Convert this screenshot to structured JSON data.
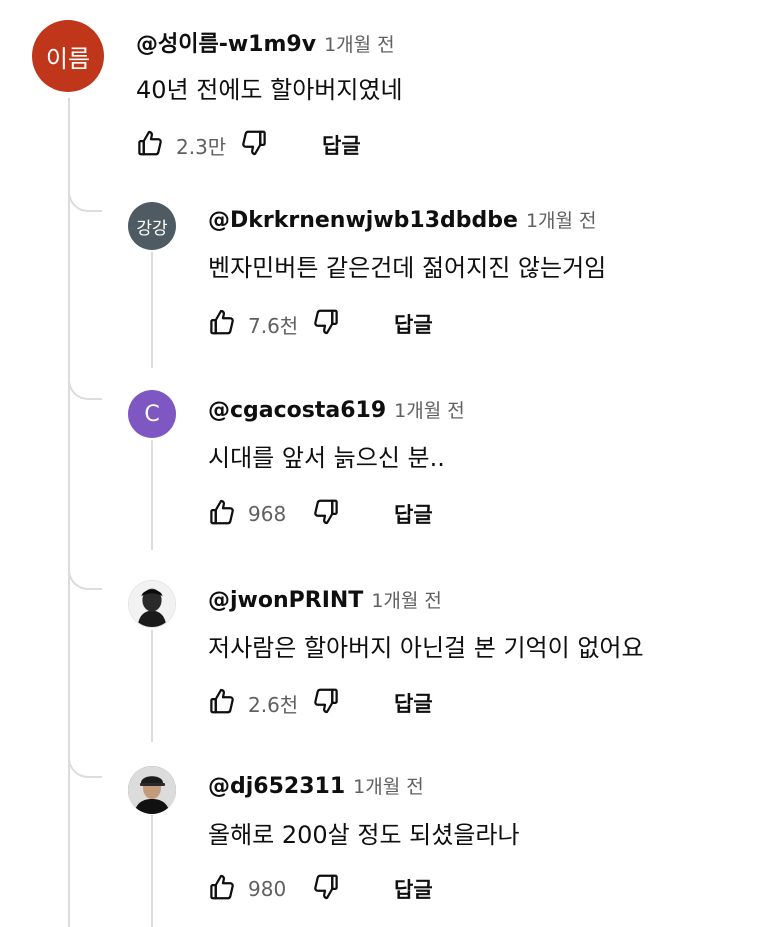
{
  "comments": [
    {
      "avatar_text": "이름",
      "avatar_color": "#c0361a",
      "handle": "@성이름-w1m9v",
      "time": "1개월 전",
      "text": "40년 전에도 할아버지였네",
      "likes": "2.3만",
      "reply_label": "답글"
    },
    {
      "avatar_text": "강강",
      "avatar_color": "#4f5b62",
      "handle": "@Dkrkrnenwjwb13dbdbe",
      "time": "1개월 전",
      "text": "벤자민버튼 같은건데 젊어지진 않는거임",
      "likes": "7.6천",
      "reply_label": "답글"
    },
    {
      "avatar_text": "C",
      "avatar_color": "#7e57c2",
      "handle": "@cgacosta619",
      "time": "1개월 전",
      "text": "시대를  앞서  늙으신 분..",
      "likes": "968",
      "reply_label": "답글"
    },
    {
      "avatar_text": "",
      "avatar_color": "#1e1e1e",
      "handle": "@jwonPRINT",
      "time": "1개월 전",
      "text": "저사람은 할아버지 아닌걸 본 기억이 없어요",
      "likes": "2.6천",
      "reply_label": "답글"
    },
    {
      "avatar_text": "",
      "avatar_color": "#3a3a3a",
      "handle": "@dj652311",
      "time": "1개월 전",
      "text": "올해로 200살 정도 되셨을라나",
      "likes": "980",
      "reply_label": "답글"
    }
  ],
  "icons": {
    "like": "thumb-up-outline",
    "dislike": "thumb-down-outline"
  }
}
